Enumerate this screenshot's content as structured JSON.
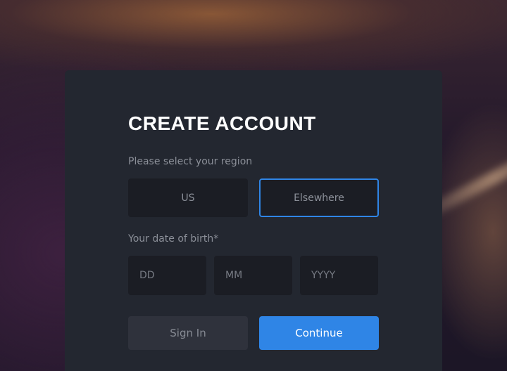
{
  "form": {
    "title": "CREATE ACCOUNT",
    "region": {
      "label": "Please select your region",
      "options": [
        "US",
        "Elsewhere"
      ],
      "selected": "Elsewhere"
    },
    "dob": {
      "label": "Your date of birth*",
      "day_placeholder": "DD",
      "month_placeholder": "MM",
      "year_placeholder": "YYYY"
    },
    "buttons": {
      "sign_in": "Sign In",
      "continue": "Continue"
    }
  },
  "colors": {
    "accent": "#2f85e6",
    "card": "#232730",
    "field": "#1b1d24"
  }
}
